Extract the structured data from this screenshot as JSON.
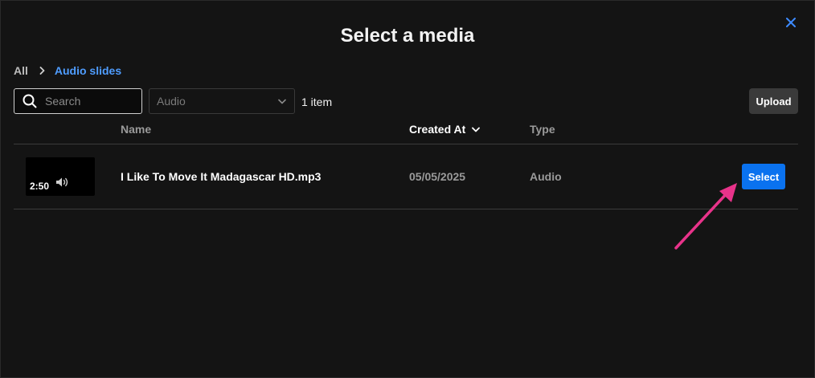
{
  "dialog": {
    "title": "Select a media"
  },
  "breadcrumb": {
    "root": "All",
    "current": "Audio slides"
  },
  "toolbar": {
    "search_placeholder": "Search",
    "type_filter_value": "Audio",
    "item_count": "1 item",
    "upload_label": "Upload"
  },
  "table": {
    "columns": {
      "name": "Name",
      "created_at": "Created At",
      "type": "Type"
    },
    "rows": [
      {
        "duration": "2:50",
        "name": "I Like To Move It Madagascar HD.mp3",
        "created_at": "05/05/2025",
        "type": "Audio",
        "action_label": "Select"
      }
    ]
  },
  "colors": {
    "background": "#141414",
    "accent": "#0a72ef",
    "link": "#4f9dff",
    "annotation": "#e8338a"
  },
  "icons": {
    "close": "close-icon",
    "search": "search-icon",
    "chevron_right": "chevron-right-icon",
    "chevron_down": "chevron-down-icon",
    "speaker": "speaker-icon"
  }
}
